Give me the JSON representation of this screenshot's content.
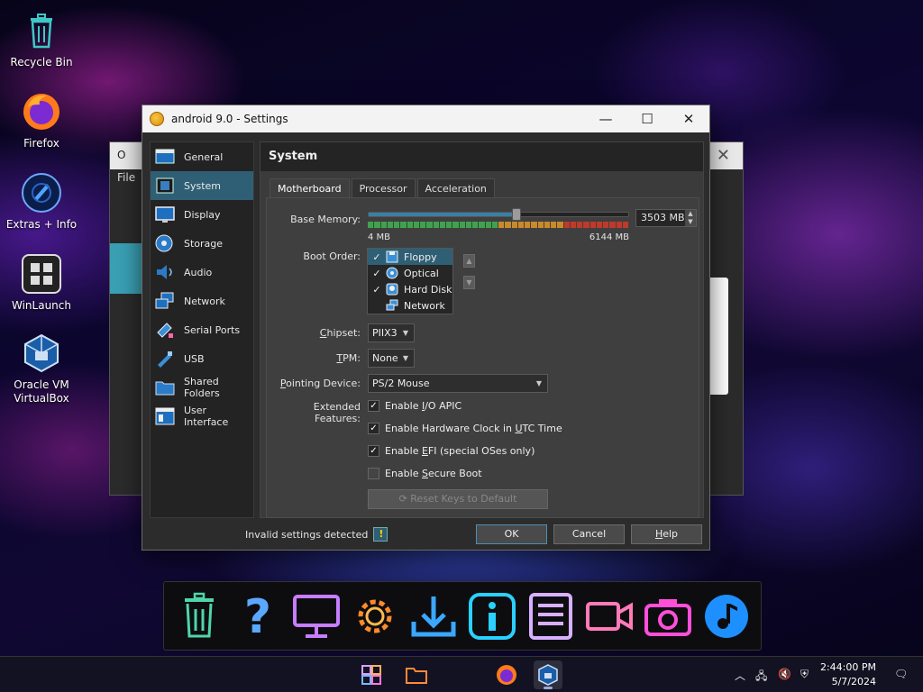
{
  "desktop": {
    "icons": [
      {
        "label": "Recycle Bin"
      },
      {
        "label": "Firefox"
      },
      {
        "label": "Extras + Info"
      },
      {
        "label": "WinLaunch"
      },
      {
        "label": "Oracle VM VirtualBox"
      }
    ]
  },
  "background_window": {
    "menu_label": "File",
    "title_initial": "O"
  },
  "dialog": {
    "title": "android 9.0 - Settings",
    "controls": {
      "minimize": "—",
      "maximize": "☐",
      "close": "✕"
    },
    "sidebar": [
      {
        "label": "General",
        "icon": "general-icon"
      },
      {
        "label": "System",
        "icon": "system-icon",
        "selected": true
      },
      {
        "label": "Display",
        "icon": "display-icon"
      },
      {
        "label": "Storage",
        "icon": "storage-icon"
      },
      {
        "label": "Audio",
        "icon": "audio-icon"
      },
      {
        "label": "Network",
        "icon": "network-icon"
      },
      {
        "label": "Serial Ports",
        "icon": "serial-ports-icon"
      },
      {
        "label": "USB",
        "icon": "usb-icon"
      },
      {
        "label": "Shared Folders",
        "icon": "shared-folders-icon"
      },
      {
        "label": "User Interface",
        "icon": "user-interface-icon"
      }
    ],
    "section_title": "System",
    "tabs": [
      "Motherboard",
      "Processor",
      "Acceleration"
    ],
    "selected_tab": "Motherboard",
    "base_memory": {
      "label": "Base Memory:",
      "value": 3503,
      "value_text": "3503 MB",
      "min_label": "4 MB",
      "max_label": "6144 MB",
      "min": 4,
      "max": 6144
    },
    "boot_order": {
      "label": "Boot Order:",
      "items": [
        {
          "label": "Floppy",
          "checked": true,
          "icon": "floppy-icon"
        },
        {
          "label": "Optical",
          "checked": true,
          "icon": "optical-icon"
        },
        {
          "label": "Hard Disk",
          "checked": true,
          "icon": "hard-disk-icon"
        },
        {
          "label": "Network",
          "checked": false,
          "icon": "network-boot-icon"
        }
      ],
      "move_up": "▲",
      "move_down": "▼"
    },
    "chipset": {
      "label": "Chipset:",
      "value": "PIIX3"
    },
    "tpm": {
      "label": "TPM:",
      "value": "None"
    },
    "pointing_device": {
      "label": "Pointing Device:",
      "value": "PS/2 Mouse"
    },
    "extended_features": {
      "label": "Extended Features:",
      "options": [
        {
          "label": "Enable I/O APIC",
          "checked": true
        },
        {
          "label": "Enable Hardware Clock in UTC Time",
          "checked": true
        },
        {
          "label": "Enable EFI (special OSes only)",
          "checked": true
        },
        {
          "label": "Enable Secure Boot",
          "checked": false
        }
      ]
    },
    "reset_keys_button": "Reset Keys to Default",
    "status": "Invalid settings detected",
    "buttons": {
      "ok": "OK",
      "cancel": "Cancel",
      "help": "Help"
    }
  },
  "dock": {
    "items": [
      "trash-icon",
      "help-icon",
      "monitor-icon",
      "gear-icon",
      "download-icon",
      "info-icon",
      "list-icon",
      "video-icon",
      "camera-icon",
      "music-icon"
    ]
  },
  "taskbar": {
    "time": "2:44:00 PM",
    "date": "5/7/2024"
  },
  "colors": {
    "selection": "#2f5f74",
    "accent": "#3a7fa6"
  }
}
